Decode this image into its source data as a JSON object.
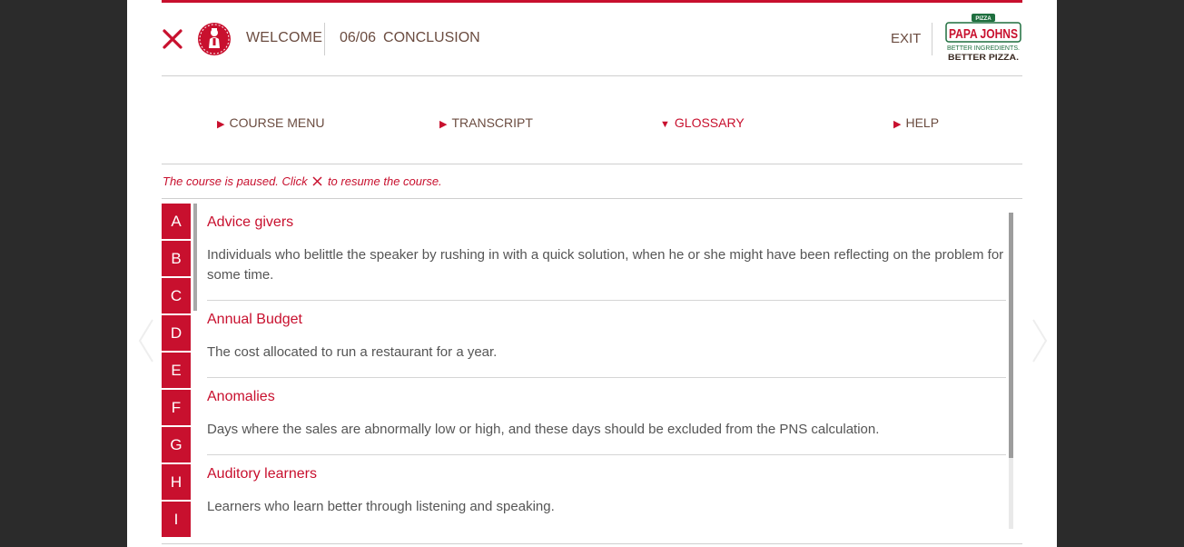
{
  "header": {
    "welcome_label": "WELCOME",
    "progress": "06/06",
    "section_title": "CONCLUSION",
    "exit_label": "EXIT",
    "logo": {
      "badge": "PIZZA",
      "brand": "PAPA JOHNS",
      "tagline_1": "BETTER INGREDIENTS.",
      "tagline_2": "BETTER PIZZA."
    }
  },
  "nav": {
    "items": [
      {
        "label": "COURSE MENU",
        "arrow": "▶",
        "active": false
      },
      {
        "label": "TRANSCRIPT",
        "arrow": "▶",
        "active": false
      },
      {
        "label": "GLOSSARY",
        "arrow": "▼",
        "active": true
      },
      {
        "label": "HELP",
        "arrow": "▶",
        "active": false
      }
    ]
  },
  "paused_message": {
    "before": "The course is paused. Click",
    "after": "to resume the course."
  },
  "glossary": {
    "letters": [
      "A",
      "B",
      "C",
      "D",
      "E",
      "F",
      "G",
      "H",
      "I"
    ],
    "entries": [
      {
        "term": "Advice givers",
        "definition": "Individuals who belittle the speaker by rushing in with a quick solution, when he or she might have been reflecting on the problem for some time."
      },
      {
        "term": "Annual Budget",
        "definition": "The cost allocated to run a restaurant for a year."
      },
      {
        "term": "Anomalies",
        "definition": "Days where the sales are abnormally low or high, and these days should be excluded from the PNS calculation."
      },
      {
        "term": "Auditory learners",
        "definition": "Learners who learn better through listening and speaking."
      }
    ]
  },
  "colors": {
    "accent": "#c8102e",
    "brand_green": "#1f6f3f",
    "text_brown": "#6b4c40",
    "backdrop": "#2b2b2b"
  },
  "icons": [
    "close-icon",
    "presenter-avatar-icon",
    "prev-arrow-icon",
    "next-arrow-icon"
  ]
}
